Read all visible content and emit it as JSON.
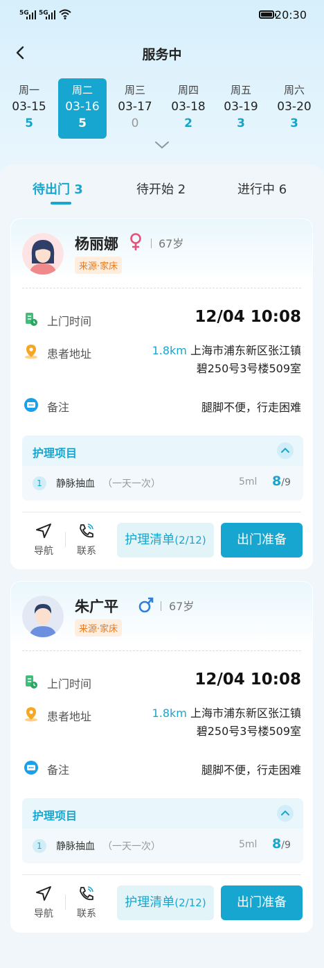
{
  "status_bar": {
    "sim1": "5G",
    "sim2": "5G",
    "time": "20:30"
  },
  "nav": {
    "title": "服务中"
  },
  "week": [
    {
      "weekday": "周一",
      "date": "03-15",
      "count": "5",
      "active": false
    },
    {
      "weekday": "周二",
      "date": "03-16",
      "count": "5",
      "active": true
    },
    {
      "weekday": "周三",
      "date": "03-17",
      "count": "0",
      "active": false
    },
    {
      "weekday": "周四",
      "date": "03-18",
      "count": "2",
      "active": false
    },
    {
      "weekday": "周五",
      "date": "03-19",
      "count": "3",
      "active": false
    },
    {
      "weekday": "周六",
      "date": "03-20",
      "count": "3",
      "active": false
    }
  ],
  "tabs": [
    {
      "label": "待出门 3",
      "active": true
    },
    {
      "label": "待开始 2",
      "active": false
    },
    {
      "label": "进行中 6",
      "active": false
    }
  ],
  "labels": {
    "visit_time": "上门时间",
    "address": "患者地址",
    "note": "备注",
    "care_items": "护理项目",
    "navigate": "导航",
    "contact": "联系",
    "care_list": "护理清单",
    "go_ready": "出门准备"
  },
  "orders": [
    {
      "name": "杨丽娜",
      "gender": "female",
      "age": "67岁",
      "source": "来源·家床",
      "visit_time": "12/04 10:08",
      "distance": "1.8km",
      "address_line1": "上海市浦东新区张江镇",
      "address_line2": "碧250号3号楼509室",
      "note": "腿脚不便，行走困难",
      "care_item": {
        "no": "1",
        "name": "静脉抽血",
        "freq": "（一天一次）",
        "amount": "5ml",
        "done": "8",
        "total": "/9"
      },
      "care_list_count": "(2/12)"
    },
    {
      "name": "朱广平",
      "gender": "male",
      "age": "67岁",
      "source": "来源·家床",
      "visit_time": "12/04 10:08",
      "distance": "1.8km",
      "address_line1": "上海市浦东新区张江镇",
      "address_line2": "碧250号3号楼509室",
      "note": "腿脚不便，行走困难",
      "care_item": {
        "no": "1",
        "name": "静脉抽血",
        "freq": "（一天一次）",
        "amount": "5ml",
        "done": "8",
        "total": "/9"
      },
      "care_list_count": "(2/12)"
    }
  ],
  "colors": {
    "accent": "#17a6cf",
    "source_tag": "#e87a1f",
    "female": "#e8507a",
    "male": "#2f7fd6"
  }
}
